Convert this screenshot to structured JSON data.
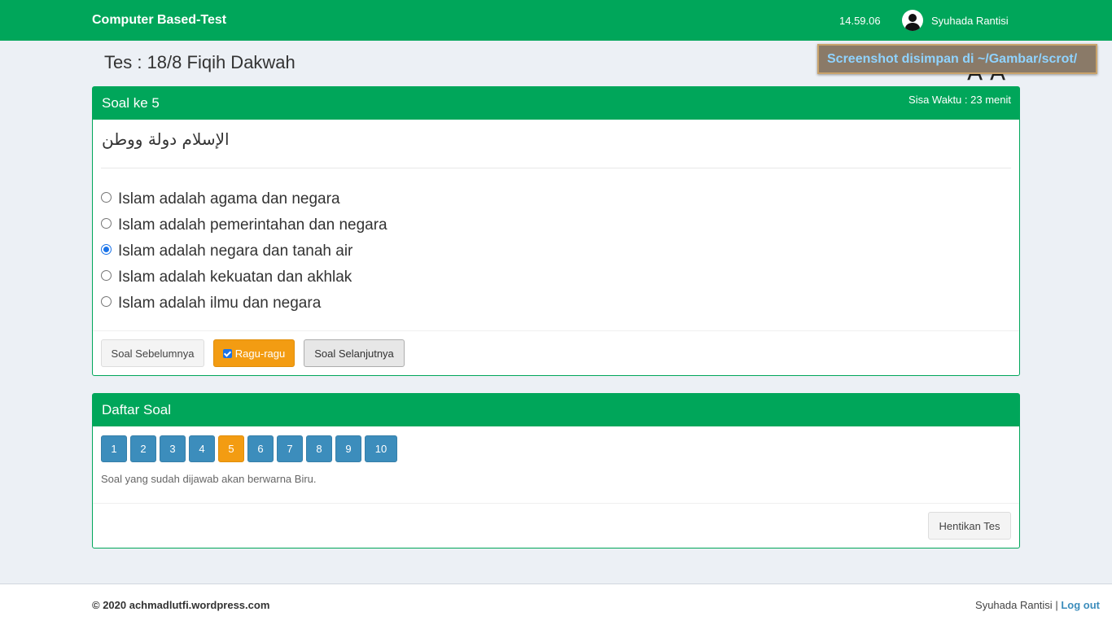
{
  "navbar": {
    "brand": "Computer Based-Test",
    "clock": "14.59.06",
    "user_name": "Syuhada Rantisi"
  },
  "page": {
    "title": "Tes : 18/8 Fiqih Dakwah",
    "font_control": "A A"
  },
  "toast": {
    "text": "Screenshot disimpan di ~/Gambar/scrot/"
  },
  "question_box": {
    "title": "Soal ke 5",
    "timer": "Sisa Waktu : 23 menit",
    "question": "الإسلام دولة ووطن",
    "options": [
      {
        "label": "Islam adalah agama dan negara",
        "checked": false
      },
      {
        "label": "Islam adalah pemerintahan dan negara",
        "checked": false
      },
      {
        "label": "Islam adalah negara dan tanah air",
        "checked": true
      },
      {
        "label": "Islam adalah kekuatan dan akhlak",
        "checked": false
      },
      {
        "label": "Islam adalah ilmu dan negara",
        "checked": false
      }
    ],
    "prev_label": "Soal Sebelumnya",
    "doubt_label": "Ragu-ragu",
    "next_label": "Soal Selanjutnya"
  },
  "list_box": {
    "title": "Daftar Soal",
    "numbers": [
      "1",
      "2",
      "3",
      "4",
      "5",
      "6",
      "7",
      "8",
      "9",
      "10"
    ],
    "active": "5",
    "hint": "Soal yang sudah dijawab akan berwarna Biru.",
    "stop_label": "Hentikan Tes"
  },
  "footer": {
    "copyright": "© 2020 achmadlutfi.wordpress.com",
    "user_name": "Syuhada Rantisi",
    "separator": "|",
    "logout": "Log out"
  },
  "colors": {
    "primary_green": "#00a65a",
    "blue": "#3c8dbc",
    "orange": "#f39c12"
  }
}
